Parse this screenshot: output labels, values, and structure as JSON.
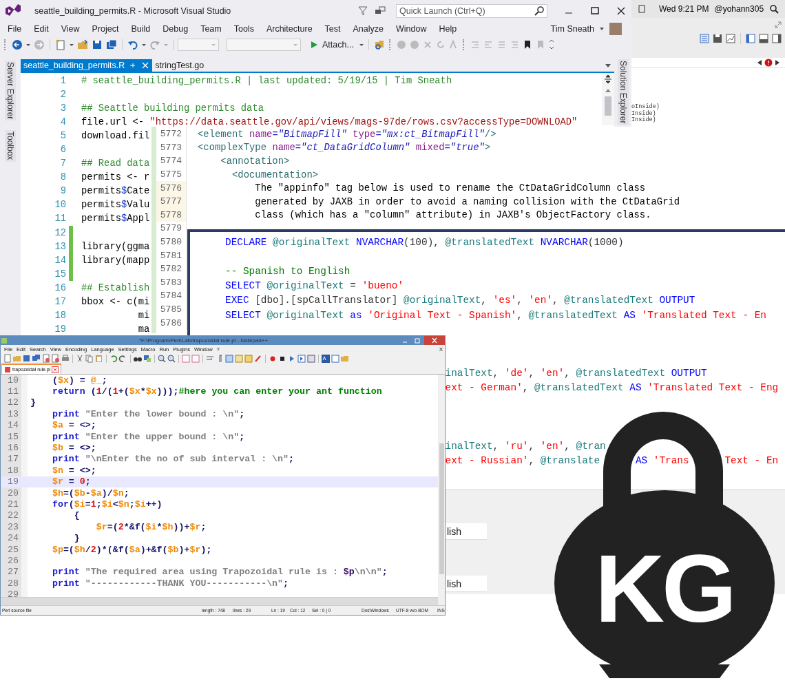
{
  "vs": {
    "title": "seattle_building_permits.R - Microsoft Visual Studio",
    "quick_launch": {
      "placeholder": "Quick Launch (Ctrl+Q)"
    },
    "menu": [
      "File",
      "Edit",
      "View",
      "Project",
      "Build",
      "Debug",
      "Team",
      "Tools",
      "Architecture",
      "Test",
      "Analyze",
      "Window",
      "Help"
    ],
    "user": "Tim Sneath",
    "attach_button": "Attach...",
    "left_tabs": [
      "Server Explorer",
      "Toolbox"
    ],
    "right_tab": "Solution Explorer",
    "tabs": [
      {
        "label": "seattle_building_permits.R",
        "selected": true
      },
      {
        "label": "stringTest.go",
        "selected": false
      }
    ],
    "lines": [
      {
        "num": "1",
        "changed": false,
        "tokens": [
          {
            "text": "# seattle_building_permits.R | last updated: 5/19/15 | Tim Sneath",
            "kind": "cmt"
          }
        ]
      },
      {
        "num": "2",
        "changed": false
      },
      {
        "num": "3",
        "changed": false,
        "tokens": [
          {
            "text": "## Seattle building permits data",
            "kind": "cmt"
          }
        ]
      },
      {
        "num": "4",
        "changed": false,
        "tokens": [
          {
            "text": "file.url <- ",
            "kind": "txt"
          },
          {
            "text": "\"https://data.seattle.gov/api/views/mags-97de/rows.csv?accessType=DOWNLOAD\"",
            "kind": "str"
          }
        ]
      },
      {
        "num": "5",
        "changed": false,
        "tokens": [
          {
            "text": "download.fil",
            "kind": "txt"
          }
        ]
      },
      {
        "num": "6",
        "changed": false
      },
      {
        "num": "7",
        "changed": false,
        "tokens": [
          {
            "text": "## Read data",
            "kind": "cmt"
          }
        ]
      },
      {
        "num": "8",
        "changed": false,
        "tokens": [
          {
            "text": "permits <- r",
            "kind": "txt"
          }
        ]
      },
      {
        "num": "9",
        "changed": false,
        "tokens": [
          {
            "text": "permits",
            "kind": "txt"
          },
          {
            "text": "$",
            "kind": "op"
          },
          {
            "text": "Cate",
            "kind": "txt"
          }
        ]
      },
      {
        "num": "10",
        "changed": false,
        "tokens": [
          {
            "text": "permits",
            "kind": "txt"
          },
          {
            "text": "$",
            "kind": "op"
          },
          {
            "text": "Valu",
            "kind": "txt"
          }
        ]
      },
      {
        "num": "11",
        "changed": false,
        "tokens": [
          {
            "text": "permits",
            "kind": "txt"
          },
          {
            "text": "$",
            "kind": "op"
          },
          {
            "text": "Appl",
            "kind": "txt"
          }
        ]
      },
      {
        "num": "12",
        "changed": true
      },
      {
        "num": "13",
        "changed": true,
        "tokens": [
          {
            "text": "library(ggma",
            "kind": "txt"
          }
        ]
      },
      {
        "num": "14",
        "changed": true,
        "tokens": [
          {
            "text": "library(mapp",
            "kind": "txt"
          }
        ]
      },
      {
        "num": "15",
        "changed": true
      },
      {
        "num": "16",
        "changed": false,
        "tokens": [
          {
            "text": "## Establish",
            "kind": "cmt"
          }
        ]
      },
      {
        "num": "17",
        "changed": false,
        "tokens": [
          {
            "text": "bbox <- c(mi",
            "kind": "txt"
          }
        ]
      },
      {
        "num": "18",
        "changed": false,
        "tokens": [
          {
            "text": "          mi",
            "kind": "txt"
          }
        ]
      },
      {
        "num": "19",
        "changed": false,
        "tokens": [
          {
            "text": "          ma",
            "kind": "txt"
          }
        ]
      }
    ]
  },
  "side_panel": {
    "clock": "Wed 9:21 PM",
    "user": "@yohann305",
    "fragments": [
      "oInside)",
      "Inside)",
      "Inside)"
    ]
  },
  "xml_editor": {
    "lines": [
      {
        "num": "5772",
        "changed": false,
        "tokens": [
          {
            "text": "<element ",
            "kind": "tag"
          },
          {
            "text": "name",
            "kind": "attr"
          },
          {
            "text": "=",
            "kind": "eq"
          },
          {
            "text": "\"BitmapFill\"",
            "kind": "val"
          },
          {
            "text": " type",
            "kind": "attr"
          },
          {
            "text": "=",
            "kind": "eq"
          },
          {
            "text": "\"mx:ct_BitmapFill\"",
            "kind": "val"
          },
          {
            "text": "/>",
            "kind": "tag"
          }
        ]
      },
      {
        "num": "5773",
        "changed": false,
        "tokens": [
          {
            "text": "<complexType ",
            "kind": "tag"
          },
          {
            "text": "name",
            "kind": "attr"
          },
          {
            "text": "=",
            "kind": "eq"
          },
          {
            "text": "\"ct_DataGridColumn\"",
            "kind": "val"
          },
          {
            "text": " mixed",
            "kind": "attr"
          },
          {
            "text": "=",
            "kind": "eq"
          },
          {
            "text": "\"true\"",
            "kind": "val"
          },
          {
            "text": ">",
            "kind": "tag"
          }
        ]
      },
      {
        "num": "5774",
        "changed": false,
        "tokens": [
          {
            "text": "    <annotation>",
            "kind": "tag"
          }
        ]
      },
      {
        "num": "5775",
        "changed": false,
        "tokens": [
          {
            "text": "      <documentation>",
            "kind": "tag"
          }
        ]
      },
      {
        "num": "5776",
        "changed": true,
        "tokens": [
          {
            "text": "          The \"appinfo\" tag below is used to rename the CtDataGridColumn class",
            "kind": "txt"
          }
        ]
      },
      {
        "num": "5777",
        "changed": true,
        "tokens": [
          {
            "text": "          generated by JAXB in order to avoid a naming collision with the CtDataGrid",
            "kind": "txt"
          }
        ]
      },
      {
        "num": "5778",
        "changed": true,
        "tokens": [
          {
            "text": "          class (which has a \"column\" attribute) in JAXB's ObjectFactory class.",
            "kind": "txt"
          }
        ]
      },
      {
        "num": "5779",
        "changed": false
      },
      {
        "num": "5780",
        "changed": false
      },
      {
        "num": "5781",
        "changed": false
      },
      {
        "num": "5782",
        "changed": false
      },
      {
        "num": "5783",
        "changed": false
      },
      {
        "num": "5784",
        "changed": false
      },
      {
        "num": "5785",
        "changed": false
      },
      {
        "num": "5786",
        "changed": false
      }
    ]
  },
  "sql_editor": {
    "lines": [
      {
        "kind": "full",
        "tokens": [
          {
            "text": "DECLARE ",
            "kind": "kw"
          },
          {
            "text": "@originalText ",
            "kind": "var"
          },
          {
            "text": "NVARCHAR",
            "kind": "kw"
          },
          {
            "text": "(100), ",
            "kind": "txt"
          },
          {
            "text": "@translatedText ",
            "kind": "var"
          },
          {
            "text": "NVARCHAR",
            "kind": "kw"
          },
          {
            "text": "(1000)",
            "kind": "txt"
          }
        ]
      },
      {
        "kind": "blank"
      },
      {
        "kind": "full",
        "tokens": [
          {
            "text": "-- Spanish to English",
            "kind": "cmt"
          }
        ]
      },
      {
        "kind": "full",
        "tokens": [
          {
            "text": "SELECT ",
            "kind": "kw"
          },
          {
            "text": "@originalText ",
            "kind": "var"
          },
          {
            "text": "= ",
            "kind": "txt"
          },
          {
            "text": "'bueno'",
            "kind": "str"
          }
        ]
      },
      {
        "kind": "full",
        "tokens": [
          {
            "text": "EXEC ",
            "kind": "kw"
          },
          {
            "text": "[dbo].[spCallTranslator] ",
            "kind": "txt"
          },
          {
            "text": "@originalText",
            "kind": "var"
          },
          {
            "text": ", ",
            "kind": "txt"
          },
          {
            "text": "'es'",
            "kind": "str"
          },
          {
            "text": ", ",
            "kind": "txt"
          },
          {
            "text": "'en'",
            "kind": "str"
          },
          {
            "text": ", ",
            "kind": "txt"
          },
          {
            "text": "@translatedText ",
            "kind": "var"
          },
          {
            "text": "OUTPUT",
            "kind": "kw"
          }
        ]
      },
      {
        "kind": "full",
        "tokens": [
          {
            "text": "SELECT ",
            "kind": "kw"
          },
          {
            "text": "@originalText ",
            "kind": "var"
          },
          {
            "text": "as ",
            "kind": "kw"
          },
          {
            "text": "'Original Text - Spanish'",
            "kind": "str"
          },
          {
            "text": ", ",
            "kind": "txt"
          },
          {
            "text": "@translatedText ",
            "kind": "var"
          },
          {
            "text": "AS ",
            "kind": "kw"
          },
          {
            "text": "'Translated Text - En",
            "kind": "str"
          }
        ]
      },
      {
        "kind": "blank"
      },
      {
        "kind": "blank"
      },
      {
        "kind": "blank"
      },
      {
        "kind": "tail",
        "tokens": [
          {
            "text": "inalText",
            "kind": "var"
          },
          {
            "text": ", ",
            "kind": "txt"
          },
          {
            "text": "'de'",
            "kind": "str"
          },
          {
            "text": ", ",
            "kind": "txt"
          },
          {
            "text": "'en'",
            "kind": "str"
          },
          {
            "text": ", ",
            "kind": "txt"
          },
          {
            "text": "@translatedText ",
            "kind": "var"
          },
          {
            "text": "OUTPUT",
            "kind": "kw"
          }
        ]
      },
      {
        "kind": "tail",
        "tokens": [
          {
            "text": "ext - German'",
            "kind": "str"
          },
          {
            "text": ", ",
            "kind": "txt"
          },
          {
            "text": "@translatedText ",
            "kind": "var"
          },
          {
            "text": "AS ",
            "kind": "kw"
          },
          {
            "text": "'Translated Text - Eng",
            "kind": "str"
          }
        ]
      },
      {
        "kind": "blank"
      },
      {
        "kind": "blank"
      },
      {
        "kind": "blank"
      },
      {
        "kind": "tail",
        "tokens": [
          {
            "text": "inalText",
            "kind": "var"
          },
          {
            "text": ", ",
            "kind": "txt"
          },
          {
            "text": "'ru'",
            "kind": "str"
          },
          {
            "text": ", ",
            "kind": "txt"
          },
          {
            "text": "'en'",
            "kind": "str"
          },
          {
            "text": ", ",
            "kind": "txt"
          },
          {
            "text": "@tran",
            "kind": "var"
          }
        ]
      },
      {
        "kind": "tail",
        "tokens": [
          {
            "text": "ext - Russian'",
            "kind": "str"
          },
          {
            "text": ", ",
            "kind": "txt"
          },
          {
            "text": "@translate",
            "kind": "var"
          },
          {
            "kind": "gap"
          },
          {
            "text": "AS ",
            "kind": "kw"
          },
          {
            "text": "'Trans",
            "kind": "str"
          },
          {
            "kind": "gap"
          },
          {
            "text": "Text - En",
            "kind": "str"
          }
        ]
      }
    ],
    "results": [
      "lish",
      "lish"
    ]
  },
  "notepad": {
    "title": "*F:\\Program\\Perl\\Lab\\trapozoidal rule.pl - Notepad++",
    "menu": [
      "File",
      "Edit",
      "Search",
      "View",
      "Encoding",
      "Language",
      "Settings",
      "Macro",
      "Run",
      "Plugins",
      "Window",
      "?"
    ],
    "close_label": "X",
    "tabs": [
      {
        "label": "trapozoidal rule.pl",
        "selected": true
      }
    ],
    "lines": [
      {
        "num": "10",
        "current": false,
        "tokens": [
          {
            "text": "    (",
            "kind": "op"
          },
          {
            "text": "$x",
            "kind": "var"
          },
          {
            "text": ") = ",
            "kind": "op"
          },
          {
            "text": "@_",
            "kind": "var"
          },
          {
            "text": ";",
            "kind": "op"
          }
        ]
      },
      {
        "num": "11",
        "current": false,
        "tokens": [
          {
            "text": "    return",
            "kind": "kw"
          },
          {
            "text": " (",
            "kind": "op"
          },
          {
            "text": "1",
            "kind": "num"
          },
          {
            "text": "/(",
            "kind": "op"
          },
          {
            "text": "1",
            "kind": "num"
          },
          {
            "text": "+(",
            "kind": "op"
          },
          {
            "text": "$x",
            "kind": "var"
          },
          {
            "text": "*",
            "kind": "op"
          },
          {
            "text": "$x",
            "kind": "var"
          },
          {
            "text": ")));",
            "kind": "op"
          },
          {
            "text": "#here you can enter your ant function",
            "kind": "cmt"
          }
        ]
      },
      {
        "num": "12",
        "current": false,
        "tokens": [
          {
            "text": "}",
            "kind": "op"
          }
        ]
      },
      {
        "num": "13",
        "current": false,
        "tokens": [
          {
            "text": "    print",
            "kind": "kw"
          },
          {
            "text": " \"Enter the lower bound : \\n\"",
            "kind": "str"
          },
          {
            "text": ";",
            "kind": "op"
          }
        ]
      },
      {
        "num": "14",
        "current": false,
        "tokens": [
          {
            "text": "    $a",
            "kind": "var"
          },
          {
            "text": " = <>;",
            "kind": "op"
          }
        ]
      },
      {
        "num": "15",
        "current": false,
        "tokens": [
          {
            "text": "    print",
            "kind": "kw"
          },
          {
            "text": " \"Enter the upper bound : \\n\"",
            "kind": "str"
          },
          {
            "text": ";",
            "kind": "op"
          }
        ]
      },
      {
        "num": "16",
        "current": false,
        "tokens": [
          {
            "text": "    $b",
            "kind": "var"
          },
          {
            "text": " = <>;",
            "kind": "op"
          }
        ]
      },
      {
        "num": "17",
        "current": false,
        "tokens": [
          {
            "text": "    print",
            "kind": "kw"
          },
          {
            "text": " \"\\nEnter the no of sub interval : \\n\"",
            "kind": "str"
          },
          {
            "text": ";",
            "kind": "op"
          }
        ]
      },
      {
        "num": "18",
        "current": false,
        "tokens": [
          {
            "text": "    $n",
            "kind": "var"
          },
          {
            "text": " = <>;",
            "kind": "op"
          }
        ]
      },
      {
        "num": "19",
        "current": true,
        "tokens": [
          {
            "text": "    $r",
            "kind": "var"
          },
          {
            "text": " = ",
            "kind": "op"
          },
          {
            "text": "0",
            "kind": "num"
          },
          {
            "text": ";",
            "kind": "op"
          }
        ]
      },
      {
        "num": "20",
        "current": false,
        "tokens": [
          {
            "text": "    $h",
            "kind": "var"
          },
          {
            "text": "=(",
            "kind": "op"
          },
          {
            "text": "$b",
            "kind": "var"
          },
          {
            "text": "-",
            "kind": "op"
          },
          {
            "text": "$a",
            "kind": "var"
          },
          {
            "text": ")/",
            "kind": "op"
          },
          {
            "text": "$n",
            "kind": "var"
          },
          {
            "text": ";",
            "kind": "op"
          }
        ]
      },
      {
        "num": "21",
        "current": false,
        "tokens": [
          {
            "text": "    for",
            "kind": "kw"
          },
          {
            "text": "(",
            "kind": "op"
          },
          {
            "text": "$i",
            "kind": "var"
          },
          {
            "text": "=",
            "kind": "op"
          },
          {
            "text": "1",
            "kind": "num"
          },
          {
            "text": ";",
            "kind": "op"
          },
          {
            "text": "$i",
            "kind": "var"
          },
          {
            "text": "<",
            "kind": "op"
          },
          {
            "text": "$n",
            "kind": "var"
          },
          {
            "text": ";",
            "kind": "op"
          },
          {
            "text": "$i",
            "kind": "var"
          },
          {
            "text": "++)",
            "kind": "op"
          }
        ]
      },
      {
        "num": "22",
        "current": false,
        "tokens": [
          {
            "text": "        {",
            "kind": "op"
          }
        ]
      },
      {
        "num": "23",
        "current": false,
        "tokens": [
          {
            "text": "            $r",
            "kind": "var"
          },
          {
            "text": "=(",
            "kind": "op"
          },
          {
            "text": "2",
            "kind": "num"
          },
          {
            "text": "*&f(",
            "kind": "op"
          },
          {
            "text": "$i",
            "kind": "var"
          },
          {
            "text": "*",
            "kind": "op"
          },
          {
            "text": "$h",
            "kind": "var"
          },
          {
            "text": "))+",
            "kind": "op"
          },
          {
            "text": "$r",
            "kind": "var"
          },
          {
            "text": ";",
            "kind": "op"
          }
        ]
      },
      {
        "num": "24",
        "current": false,
        "tokens": [
          {
            "text": "        }",
            "kind": "op"
          }
        ]
      },
      {
        "num": "25",
        "current": false,
        "tokens": [
          {
            "text": "    $p",
            "kind": "var"
          },
          {
            "text": "=(",
            "kind": "op"
          },
          {
            "text": "$h",
            "kind": "var"
          },
          {
            "text": "/",
            "kind": "op"
          },
          {
            "text": "2",
            "kind": "num"
          },
          {
            "text": ")*(&f(",
            "kind": "op"
          },
          {
            "text": "$a",
            "kind": "var"
          },
          {
            "text": ")+&f(",
            "kind": "op"
          },
          {
            "text": "$b",
            "kind": "var"
          },
          {
            "text": ")+",
            "kind": "op"
          },
          {
            "text": "$r",
            "kind": "var"
          },
          {
            "text": ");",
            "kind": "op"
          }
        ]
      },
      {
        "num": "26",
        "current": false
      },
      {
        "num": "27",
        "current": false,
        "tokens": [
          {
            "text": "    print",
            "kind": "kw"
          },
          {
            "text": " \"The required area using Trapozoidal rule is : ",
            "kind": "str"
          },
          {
            "text": "$p",
            "kind": "ivar"
          },
          {
            "text": "\\n\\n\"",
            "kind": "str"
          },
          {
            "text": ";",
            "kind": "op"
          }
        ]
      },
      {
        "num": "28",
        "current": false,
        "tokens": [
          {
            "text": "    print",
            "kind": "kw"
          },
          {
            "text": " \"------------THANK YOU-----------\\n\"",
            "kind": "str"
          },
          {
            "text": ";",
            "kind": "op"
          }
        ]
      },
      {
        "num": "29",
        "current": false
      }
    ],
    "status": [
      "Perl source file",
      "length : 748",
      "lines : 29",
      "Ln : 19",
      "Col : 12",
      "Sel : 0 | 0",
      "Dos\\Windows",
      "UTF-8 w/o BOM",
      "INS"
    ]
  },
  "logo": {
    "text": "KG"
  }
}
